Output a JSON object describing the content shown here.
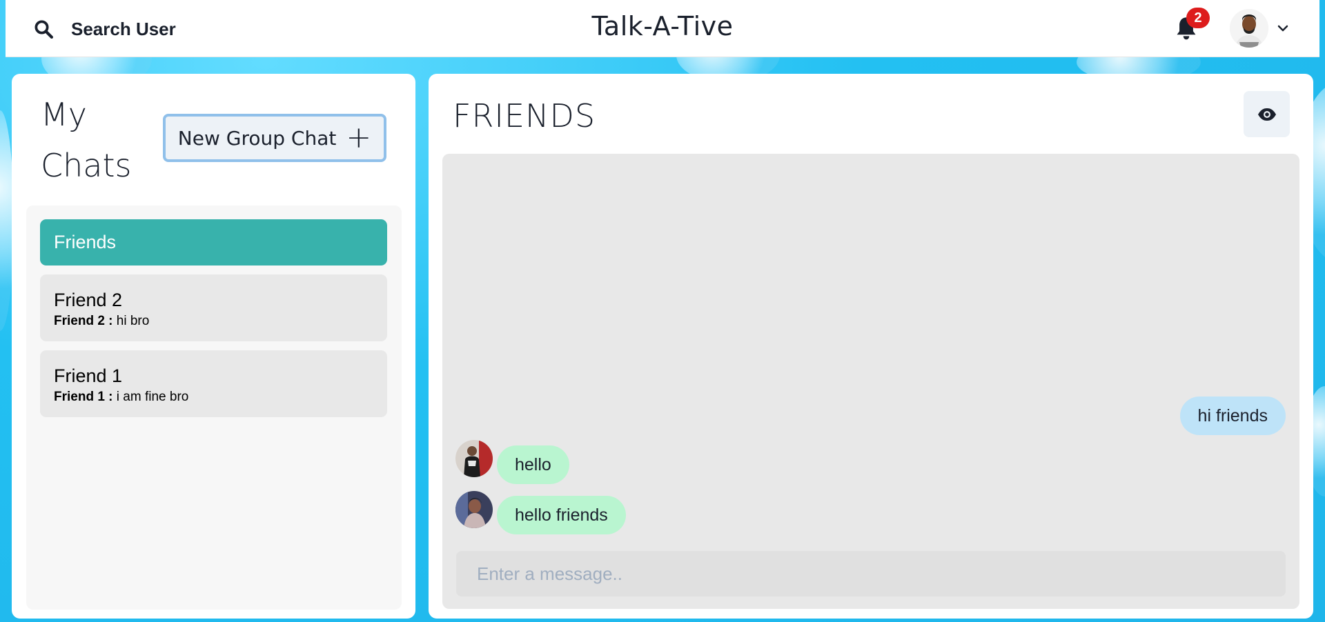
{
  "header": {
    "search_label": "Search User",
    "app_title": "Talk-A-Tive",
    "notification_count": "2"
  },
  "sidebar": {
    "title": "My Chats",
    "new_group_label": "New Group Chat",
    "new_group_icon": "+",
    "chats": [
      {
        "name": "Friends",
        "active": true
      },
      {
        "name": "Friend 2",
        "latest_sender": "Friend 2 :",
        "latest_text": "hi bro"
      },
      {
        "name": "Friend 1",
        "latest_sender": "Friend 1 :",
        "latest_text": "i am fine bro"
      }
    ]
  },
  "chat": {
    "title": "FRIENDS",
    "messages": [
      {
        "text": "hi friends",
        "from_me": true
      },
      {
        "text": "hello",
        "from_me": false
      },
      {
        "text": "hello friends",
        "from_me": false
      }
    ],
    "input_placeholder": "Enter a message.."
  },
  "colors": {
    "active_chat": "#38b2ac",
    "my_message": "#bee3f8",
    "other_message": "#b9f5d0",
    "badge": "#dd1c1c",
    "background": "#29c4f2"
  },
  "icons": {
    "search": "search-icon",
    "bell": "bell-icon",
    "chevron": "chevron-down-icon",
    "eye": "eye-icon",
    "plus": "plus-icon"
  }
}
